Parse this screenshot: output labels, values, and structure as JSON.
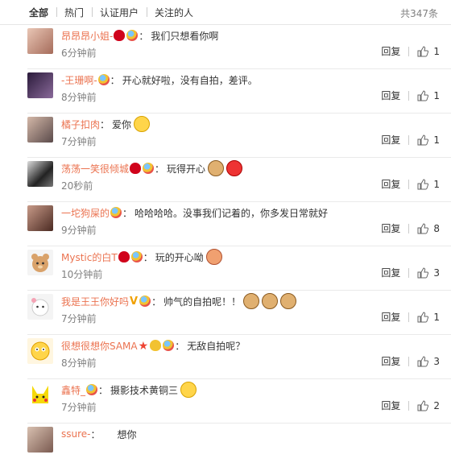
{
  "tabs": [
    "全部",
    "热门",
    "认证用户",
    "关注的人"
  ],
  "total": "共347条",
  "reply_label": "回复",
  "comments": [
    {
      "user": "昂昂昂小姐-",
      "text": "我们只想看你啊",
      "time": "6分钟前",
      "likes": "1"
    },
    {
      "user": "-王珊啊-",
      "text": "开心就好啦，没有自拍，差评。",
      "time": "8分钟前",
      "likes": "1"
    },
    {
      "user": "橘子扣肉",
      "text": "爱你",
      "time": "7分钟前",
      "likes": "1"
    },
    {
      "user": "荡荡一笑很倾城",
      "text": "玩得开心",
      "time": "20秒前",
      "likes": "1"
    },
    {
      "user": "一坨狗屎的",
      "text": "哈哈哈哈。没事我们记着的，你多发日常就好",
      "time": "9分钟前",
      "likes": "8"
    },
    {
      "user": "Mystic的白T",
      "text": "玩的开心呦",
      "time": "10分钟前",
      "likes": "3"
    },
    {
      "user": "我是王王你好吗",
      "text": "帅气的自拍呢！！",
      "time": "7分钟前",
      "likes": "1"
    },
    {
      "user": "很想很想你SAMA",
      "text": "无敌自拍呢？",
      "time": "8分钟前",
      "likes": "3"
    },
    {
      "user": "鑫特_",
      "text": "摄影技术黄铜三",
      "time": "7分钟前",
      "likes": "2"
    },
    {
      "user": "ssure-",
      "text": "想你",
      "time": "",
      "likes": ""
    }
  ],
  "colors": {
    "username": "#eb7350",
    "muted": "#808080"
  }
}
